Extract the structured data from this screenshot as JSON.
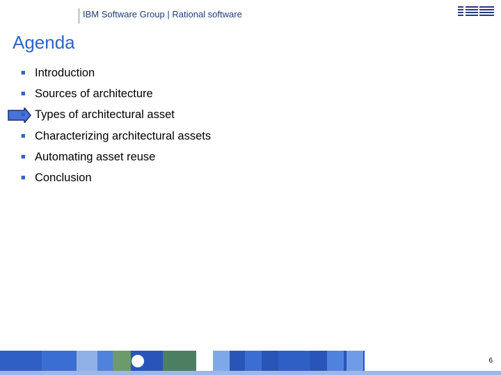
{
  "header": {
    "text": "IBM Software Group | Rational software",
    "logo_icon": "ibm-logo-icon"
  },
  "title": "Agenda",
  "agenda": {
    "current_marker_icon": "right-arrow-icon",
    "items": [
      {
        "label": "Introduction"
      },
      {
        "label": "Sources of architecture"
      },
      {
        "label": "Types of architectural asset"
      },
      {
        "label": "Characterizing architectural assets"
      },
      {
        "label": "Automating asset reuse"
      },
      {
        "label": "Conclusion"
      }
    ]
  },
  "footer": {
    "page_number": "6"
  },
  "colors": {
    "accent": "#2f63c8",
    "footer_band": "#2a55b8",
    "arrow_fill": "#4a73d9"
  }
}
